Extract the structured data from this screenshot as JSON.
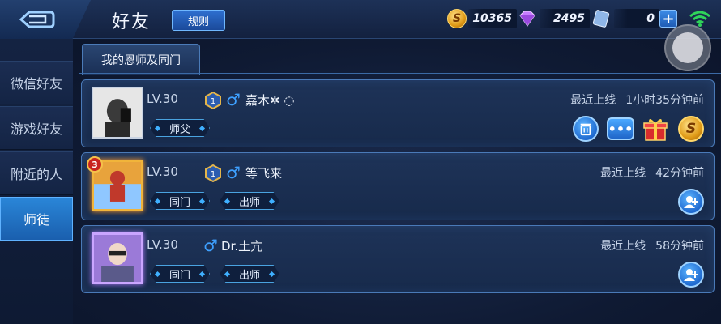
{
  "header": {
    "title": "好友",
    "rules_label": "规则",
    "gold": "10365",
    "diamonds": "2495",
    "vouchers": "0",
    "plus": "+"
  },
  "sidebar": {
    "items": [
      {
        "label": "微信好友",
        "active": false
      },
      {
        "label": "游戏好友",
        "active": false
      },
      {
        "label": "附近的人",
        "active": false
      },
      {
        "label": "师徒",
        "active": true
      }
    ]
  },
  "section": {
    "title": "我的恩师及同门"
  },
  "rows": [
    {
      "level": "LV.30",
      "hero_rank": "1",
      "name": "嘉木✲ ◌",
      "online_label": "最近上线",
      "online_time": "1小时35分钟前",
      "tags": [
        "师父"
      ],
      "actions": [
        "delete-icon",
        "chat-icon",
        "gift-icon",
        "gold-coin-icon"
      ]
    },
    {
      "level": "LV.30",
      "rank_badge": "3",
      "hero_rank": "1",
      "name": "等飞来",
      "online_label": "最近上线",
      "online_time": "42分钟前",
      "tags": [
        "同门",
        "出师"
      ],
      "actions": [
        "add-friend-icon"
      ]
    },
    {
      "level": "LV.30",
      "name": "Dr.土亢",
      "online_label": "最近上线",
      "online_time": "58分钟前",
      "tags": [
        "同门",
        "出师"
      ],
      "actions": [
        "add-friend-icon"
      ]
    }
  ],
  "colors": {
    "accent": "#2a86d8",
    "panel_border": "#4a7ab8",
    "gold": "#e09a16",
    "male": "#3ea0ff"
  }
}
